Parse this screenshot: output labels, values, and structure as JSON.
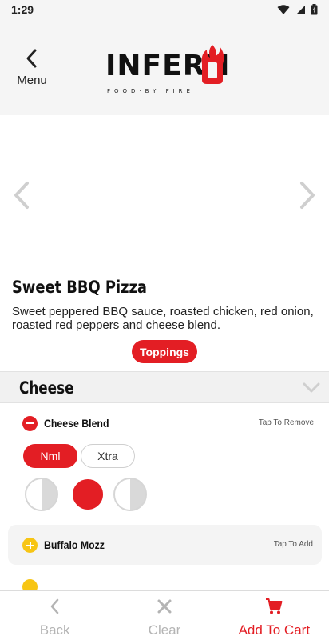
{
  "status_bar": {
    "time": "1:29"
  },
  "header": {
    "back_label": "Menu",
    "logo_text": "INFERN",
    "logo_tagline": "FOOD·BY·FIRE"
  },
  "product": {
    "name": "Sweet BBQ Pizza",
    "description": "Sweet peppered BBQ sauce, roasted chicken, red onion, roasted red peppers and cheese blend.",
    "toppings_button": "Toppings"
  },
  "section": {
    "title": "Cheese"
  },
  "toppings": [
    {
      "name": "Cheese Blend",
      "action": "Tap To Remove",
      "selected": true
    },
    {
      "name": "Buffalo Mozz",
      "action": "Tap To Add",
      "selected": false
    }
  ],
  "amount_options": [
    "Nml",
    "Xtra"
  ],
  "amount_selected": "Nml",
  "portion_options": [
    "left-half",
    "whole",
    "right-half"
  ],
  "portion_selected": "whole",
  "bottom_bar": {
    "back": "Back",
    "clear": "Clear",
    "add_to_cart": "Add To Cart"
  },
  "colors": {
    "accent": "#e31e24",
    "add_yellow": "#f7c514",
    "muted": "#b4b4b4"
  }
}
